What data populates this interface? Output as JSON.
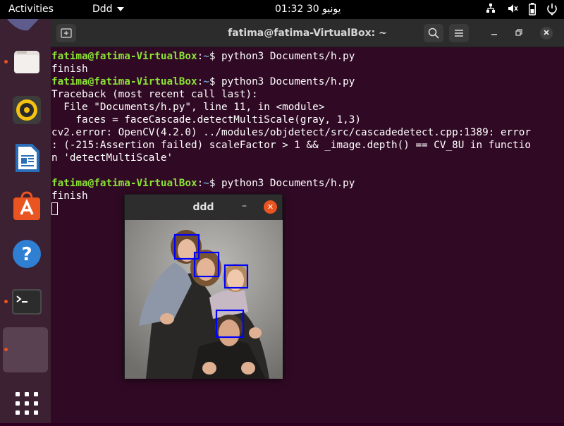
{
  "topbar": {
    "activities": "Activities",
    "app_menu": "Ddd",
    "clock": "01:32  يونيو 30",
    "network_icon": "network-icon",
    "volume_icon": "volume-icon",
    "battery_icon": "battery-icon",
    "power_icon": "power-icon"
  },
  "dock": {
    "items": [
      {
        "name": "files",
        "icon": "folder-icon",
        "running": true
      },
      {
        "name": "rhythmbox",
        "icon": "speaker-icon",
        "running": false
      },
      {
        "name": "libreoffice-writer",
        "icon": "document-icon",
        "running": false
      },
      {
        "name": "ubuntu-software",
        "icon": "shopping-bag-icon",
        "running": false
      },
      {
        "name": "help",
        "icon": "help-icon",
        "running": false
      },
      {
        "name": "terminal",
        "icon": "terminal-icon",
        "running": true
      },
      {
        "name": "ddd-window",
        "icon": "blank-window-icon",
        "running": true
      },
      {
        "name": "show-applications",
        "icon": "app-grid-icon",
        "running": false
      }
    ]
  },
  "terminal": {
    "title": "fatima@fatima-VirtualBox: ~",
    "new_tab_icon": "new-tab-icon",
    "search_icon": "search-icon",
    "menu_icon": "hamburger-menu-icon",
    "user_host": "fatima@fatima-VirtualBox",
    "path": "~",
    "prompt_suffix": "$ ",
    "lines": [
      {
        "type": "prompt",
        "cmd": "python3 Documents/h.py"
      },
      {
        "type": "out",
        "text": "finish"
      },
      {
        "type": "prompt",
        "cmd": "python3 Documents/h.py"
      },
      {
        "type": "out",
        "text": "Traceback (most recent call last):"
      },
      {
        "type": "out",
        "text": "  File \"Documents/h.py\", line 11, in <module>"
      },
      {
        "type": "out",
        "text": "    faces = faceCascade.detectMultiScale(gray, 1,3)"
      },
      {
        "type": "out",
        "text": "cv2.error: OpenCV(4.2.0) ../modules/objdetect/src/cascadedetect.cpp:1389: error"
      },
      {
        "type": "out",
        "text": ": (-215:Assertion failed) scaleFactor > 1 && _image.depth() == CV_8U in functio"
      },
      {
        "type": "out",
        "text": "n 'detectMultiScale'"
      },
      {
        "type": "out",
        "text": ""
      },
      {
        "type": "prompt",
        "cmd": "python3 Documents/h.py"
      },
      {
        "type": "out",
        "text": "finish"
      },
      {
        "type": "cursor"
      }
    ]
  },
  "image_window": {
    "title": "ddd",
    "minimize_label": "–",
    "close_label": "✕",
    "face_box_color": "#0000ff",
    "detected_faces": 4
  },
  "colors": {
    "terminal_bg": "#300a24",
    "prompt_user": "#8ae234",
    "prompt_path": "#729fcf",
    "accent": "#e95420"
  }
}
